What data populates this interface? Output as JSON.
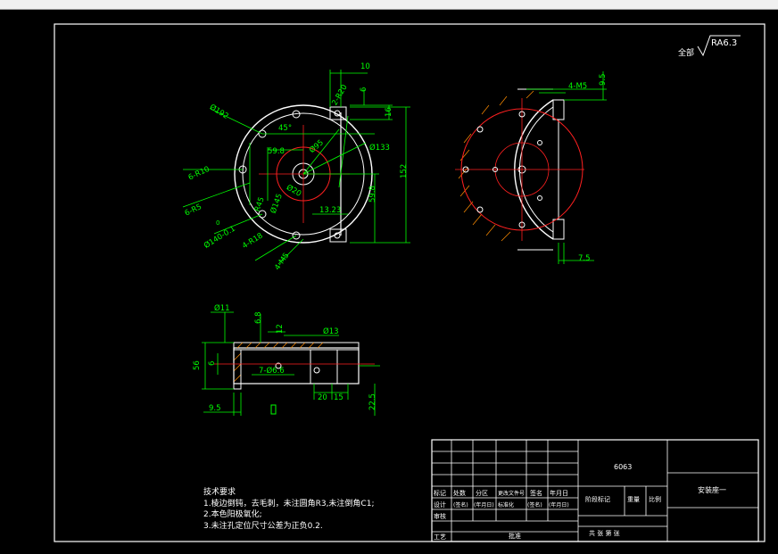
{
  "window": {
    "title_bar": ""
  },
  "roughness": {
    "prefix": "全部",
    "value": "RA6.3"
  },
  "front_view_dims": {
    "d10": "10",
    "r20": "2-R20",
    "d6": "6",
    "d16": "16",
    "d152": "152",
    "dia192": "Ø192",
    "a45": "45°",
    "dia133": "Ø133",
    "dia95": "Ø95",
    "d59_8a": "59.8",
    "r10": "6-R10",
    "r5": "6-R5",
    "r45": "R45",
    "dia145": "Ø145",
    "d20": "Ø20",
    "d13_23": "13.23",
    "d59_8b": "59.8",
    "dia140": "Ø140-0.1",
    "tol0": "0",
    "r18": "4-R18",
    "m5": "4-M5"
  },
  "side_view_dims": {
    "m5": "4-M5",
    "d9_5": "9.5",
    "d7_5": "7.5"
  },
  "section_view_dims": {
    "dia11": "Ø11",
    "d6_8": "6.8",
    "d12": "12",
    "dia13": "Ø13",
    "d56": "56",
    "d6": "6",
    "holes": "7-Ø6.6",
    "d20": "20",
    "d15": "15",
    "d9_5": "9.5",
    "d22_5": "22.5"
  },
  "notes": {
    "title": "技术要求",
    "items": [
      "1.棱边倒钝，去毛刺，未注圆角R3,未注倒角C1;",
      "2.本色阳极氧化;",
      "3.未注孔定位尺寸公差为正负0.2."
    ]
  },
  "title_block": {
    "material": "6063",
    "part_name": "安装座一",
    "row1": [
      "标记",
      "处数",
      "分区",
      "更改文件号",
      "签名",
      "年月日"
    ],
    "row2": [
      "设计",
      "(签名)",
      "(年月日)",
      "标准化",
      "(签名)",
      "(年月日)"
    ],
    "mark_label": "阶段标记",
    "weight_label": "重量",
    "scale_label": "比例",
    "review": "审核",
    "craft": "工艺",
    "approve": "批准",
    "sheet_text": "共  张  第  张"
  },
  "colors": {
    "frame": "#ffffff",
    "dims": "#00ff00",
    "center": "#ff2020",
    "part": "#ffffff"
  }
}
